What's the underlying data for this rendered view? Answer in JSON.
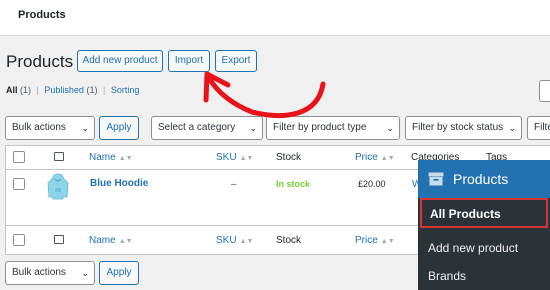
{
  "topbar": {
    "title": "Products"
  },
  "header": {
    "page_title": "Products",
    "add_new_label": "Add new product",
    "import_label": "Import",
    "export_label": "Export"
  },
  "views": [
    {
      "label": "All",
      "count": "(1)",
      "current": true
    },
    {
      "label": "Published",
      "count": "(1)"
    },
    {
      "label": "Sorting"
    }
  ],
  "filters_top": {
    "bulk_actions": "Bulk actions",
    "apply": "Apply",
    "category": "Select a category",
    "product_type": "Filter by product type",
    "stock_status": "Filter by stock status",
    "truncated": "Filte"
  },
  "table": {
    "columns": {
      "name": "Name",
      "sku": "SKU",
      "stock": "Stock",
      "price": "Price",
      "categories": "Categories",
      "tags": "Tags"
    },
    "rows": [
      {
        "name": "Blue Hoodie",
        "sku": "–",
        "stock": "In stock",
        "price": "£20.00",
        "category_trunc": "W"
      }
    ]
  },
  "filters_bottom": {
    "bulk_actions": "Bulk actions",
    "apply": "Apply"
  },
  "flyout_menu": {
    "header": "Products",
    "items": [
      "All Products",
      "Add new product",
      "Brands"
    ]
  },
  "colors": {
    "accent": "#2271b1",
    "stock_green": "#7ad03a",
    "annotation_red": "#e8121a",
    "menu_bg": "#2c3338"
  }
}
